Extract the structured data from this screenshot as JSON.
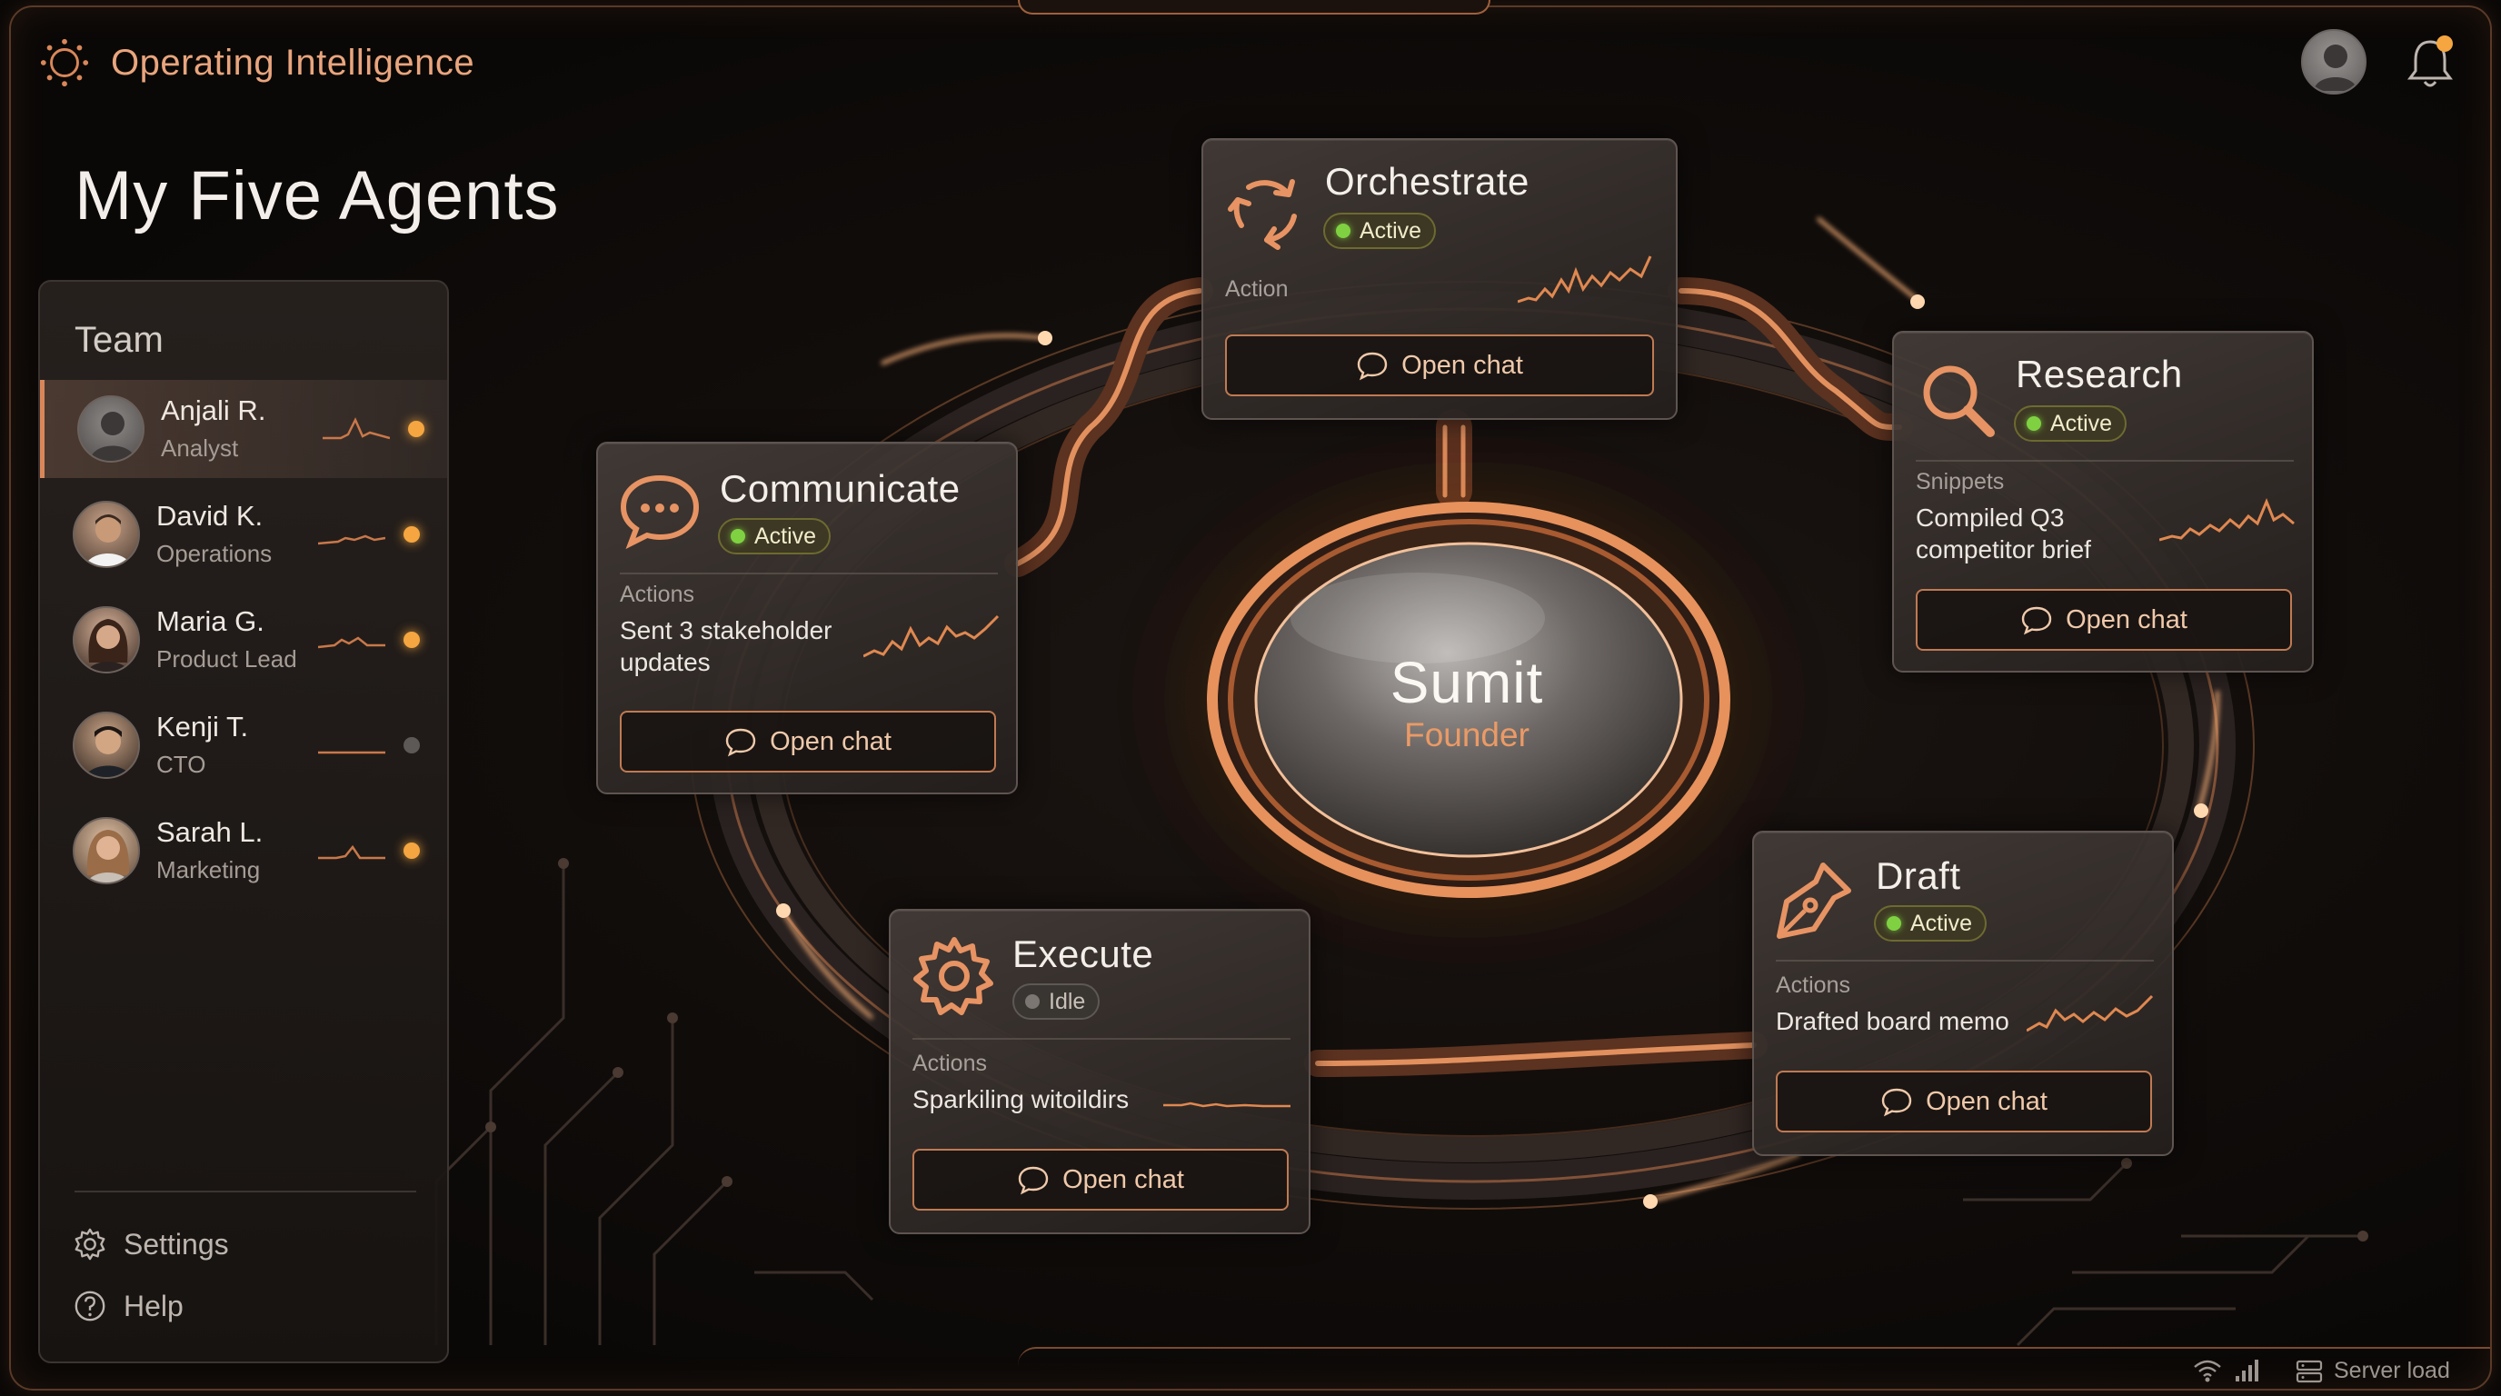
{
  "app": {
    "name": "Operating Intelligence",
    "logo_icon": "orbit-logo-icon"
  },
  "header": {
    "avatar_icon": "user-avatar-icon",
    "notification_icon": "bell-icon",
    "notification_dot_color": "#f5a640"
  },
  "page": {
    "title": "My Five Agents"
  },
  "sidebar": {
    "title": "Team",
    "members": [
      {
        "name": "Anjali R.",
        "role": "Analyst",
        "status": "online",
        "selected": true
      },
      {
        "name": "David K.",
        "role": "Operations",
        "status": "online"
      },
      {
        "name": "Maria G.",
        "role": "Product Lead",
        "status": "online"
      },
      {
        "name": "Kenji T.",
        "role": "CTO",
        "status": "offline"
      },
      {
        "name": "Sarah L.",
        "role": "Marketing",
        "status": "online"
      }
    ],
    "settings_label": "Settings",
    "help_label": "Help"
  },
  "hub": {
    "name": "Sumit",
    "role": "Founder"
  },
  "agents": {
    "orchestrate": {
      "title": "Orchestrate",
      "status": "Active",
      "label": "Action",
      "text": "",
      "button": "Open chat",
      "icon": "refresh-cycle-icon"
    },
    "research": {
      "title": "Research",
      "status": "Active",
      "label": "Snippets",
      "text_line1": "Compiled Q3",
      "text_line2": "competitor brief",
      "button": "Open chat",
      "icon": "magnifier-icon"
    },
    "communicate": {
      "title": "Communicate",
      "status": "Active",
      "label": "Actions",
      "text_line1": "Sent 3 stakeholder",
      "text_line2": "updates",
      "button": "Open chat",
      "icon": "chat-bubble-icon"
    },
    "execute": {
      "title": "Execute",
      "status": "Idle",
      "label": "Actions",
      "text": "Sparkiling witoildirs",
      "button": "Open chat",
      "icon": "gear-icon"
    },
    "draft": {
      "title": "Draft",
      "status": "Active",
      "label": "Actions",
      "text": "Drafted board memo",
      "button": "Open chat",
      "icon": "pen-nib-icon"
    }
  },
  "statusbar": {
    "server_label": "Server load",
    "wifi_icon": "wifi-icon",
    "signal_icon": "signal-bars-icon",
    "server_icon": "server-icon"
  },
  "colors": {
    "accent": "#d9875a",
    "copper": "#c07a52",
    "active_green": "#7fd142",
    "bg": "#0a0807"
  }
}
